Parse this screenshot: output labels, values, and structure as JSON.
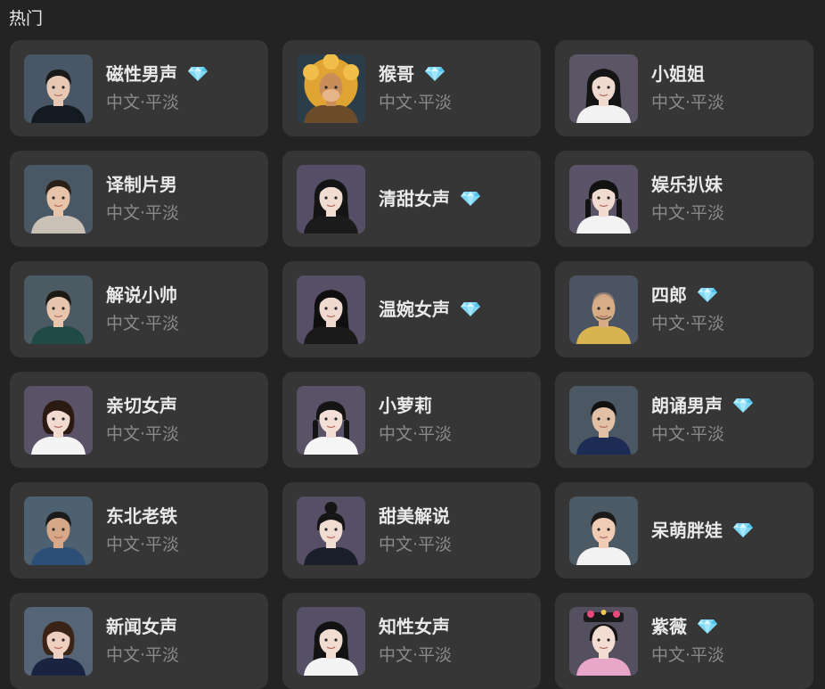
{
  "section": {
    "title": "热门"
  },
  "colors": {
    "background": "#232323",
    "card": "#363636",
    "text_primary": "#e9e9e9",
    "text_secondary": "#8a8a8a",
    "premium_gem": "#7fd8f6"
  },
  "voices": [
    {
      "name": "磁性男声",
      "tag": "中文·平淡",
      "premium": true,
      "avatar": {
        "bg": "#485665",
        "skin": "#e6c8b4",
        "hair": "#1a1a1a",
        "hairStyle": "short",
        "clothes": "#141a22"
      }
    },
    {
      "name": "猴哥",
      "tag": "中文·平淡",
      "premium": true,
      "avatar": {
        "bg": "#2c3d4a",
        "skin": "#c98d5a",
        "hair": "#e0a433",
        "hairStyle": "mane",
        "clothes": "#6b4b2a"
      }
    },
    {
      "name": "小姐姐",
      "tag": "中文·平淡",
      "premium": false,
      "avatar": {
        "bg": "#5b5566",
        "skin": "#f0d9cf",
        "hair": "#151515",
        "hairStyle": "long",
        "clothes": "#f2f2f2"
      }
    },
    {
      "name": "译制片男",
      "tag": "中文·平淡",
      "premium": false,
      "avatar": {
        "bg": "#4a5866",
        "skin": "#e7c3a9",
        "hair": "#2a2018",
        "hairStyle": "short",
        "clothes": "#c9c1b6"
      }
    },
    {
      "name": "清甜女声",
      "tag": "",
      "premium": true,
      "single": true,
      "avatar": {
        "bg": "#554e66",
        "skin": "#f1dcd2",
        "hair": "#141414",
        "hairStyle": "long",
        "clothes": "#1b1b1b"
      }
    },
    {
      "name": "娱乐扒妹",
      "tag": "中文·平淡",
      "premium": false,
      "avatar": {
        "bg": "#5b5468",
        "skin": "#f1dbd0",
        "hair": "#121212",
        "hairStyle": "braids",
        "clothes": "#f3f3f3"
      }
    },
    {
      "name": "解说小帅",
      "tag": "中文·平淡",
      "premium": false,
      "avatar": {
        "bg": "#4c5a63",
        "skin": "#e8c6ad",
        "hair": "#1c1813",
        "hairStyle": "short",
        "clothes": "#1f4a45"
      }
    },
    {
      "name": "温婉女声",
      "tag": "",
      "premium": true,
      "single": true,
      "avatar": {
        "bg": "#564f66",
        "skin": "#f0dad0",
        "hair": "#0f0f0f",
        "hairStyle": "long",
        "clothes": "#1a1a1a"
      }
    },
    {
      "name": "四郎",
      "tag": "中文·平淡",
      "premium": true,
      "avatar": {
        "bg": "#4a5462",
        "skin": "#d7ad88",
        "hair": "#6a5a4a",
        "hairStyle": "bald",
        "clothes": "#d8b450"
      }
    },
    {
      "name": "亲切女声",
      "tag": "中文·平淡",
      "premium": false,
      "avatar": {
        "bg": "#5a5266",
        "skin": "#f1dbd1",
        "hair": "#2a1a12",
        "hairStyle": "bob",
        "clothes": "#f4f4f4"
      }
    },
    {
      "name": "小萝莉",
      "tag": "中文·平淡",
      "premium": false,
      "avatar": {
        "bg": "#5a5368",
        "skin": "#f3dfd6",
        "hair": "#141414",
        "hairStyle": "braids",
        "clothes": "#f5f5f5"
      }
    },
    {
      "name": "朗诵男声",
      "tag": "中文·平淡",
      "premium": true,
      "avatar": {
        "bg": "#4b5864",
        "skin": "#e2c0a6",
        "hair": "#111111",
        "hairStyle": "short",
        "clothes": "#1d2c54"
      }
    },
    {
      "name": "东北老铁",
      "tag": "中文·平淡",
      "premium": false,
      "avatar": {
        "bg": "#4e6170",
        "skin": "#d7a888",
        "hair": "#1b1b1b",
        "hairStyle": "short",
        "clothes": "#2c4f77"
      }
    },
    {
      "name": "甜美解说",
      "tag": "中文·平淡",
      "premium": false,
      "avatar": {
        "bg": "#564f66",
        "skin": "#f1dcd2",
        "hair": "#151515",
        "hairStyle": "bun",
        "clothes": "#1a1d2a"
      }
    },
    {
      "name": "呆萌胖娃",
      "tag": "",
      "premium": true,
      "single": true,
      "avatar": {
        "bg": "#4c5a66",
        "skin": "#efccb3",
        "hair": "#1b1b1b",
        "hairStyle": "short",
        "clothes": "#f2f2f2"
      }
    },
    {
      "name": "新闻女声",
      "tag": "中文·平淡",
      "premium": false,
      "avatar": {
        "bg": "#556577",
        "skin": "#efcfbf",
        "hair": "#3a2418",
        "hairStyle": "bob",
        "clothes": "#1a2340"
      }
    },
    {
      "name": "知性女声",
      "tag": "中文·平淡",
      "premium": false,
      "avatar": {
        "bg": "#555066",
        "skin": "#f1dcd2",
        "hair": "#121212",
        "hairStyle": "long",
        "clothes": "#f4f4f4"
      }
    },
    {
      "name": "紫薇",
      "tag": "中文·平淡",
      "premium": true,
      "avatar": {
        "bg": "#54505f",
        "skin": "#f3ddd3",
        "hair": "#131313",
        "hairStyle": "qing",
        "clothes": "#e8a7c8"
      }
    }
  ]
}
